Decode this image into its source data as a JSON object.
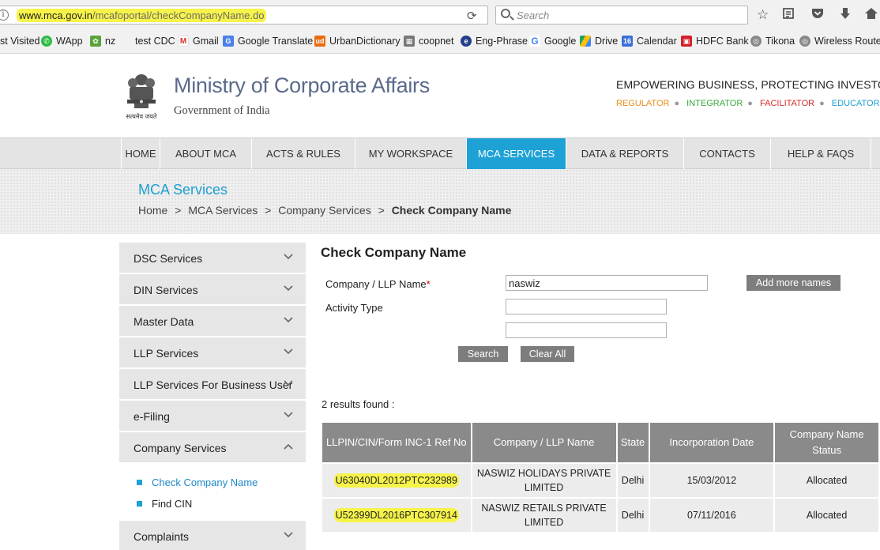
{
  "browser": {
    "url_host": "www.mca.gov.in",
    "url_path": "/mcafoportal/checkCompanyName.do",
    "search_placeholder": "Search",
    "bookmarks": [
      {
        "label": "st Visited"
      },
      {
        "label": "WApp"
      },
      {
        "label": "nz"
      },
      {
        "label": "test CDC"
      },
      {
        "label": "Gmail"
      },
      {
        "label": "Google Translate"
      },
      {
        "label": "UrbanDictionary"
      },
      {
        "label": "coopnet"
      },
      {
        "label": "Eng-Phrase"
      },
      {
        "label": "Google"
      },
      {
        "label": "Drive"
      },
      {
        "label": "Calendar"
      },
      {
        "label": "HDFC Bank"
      },
      {
        "label": "Tikona"
      },
      {
        "label": "Wireless Router"
      }
    ]
  },
  "header": {
    "title": "Ministry of Corporate Affairs",
    "subtitle": "Government of India",
    "emblem_caption": "सत्यमेव जयते",
    "tagline": "EMPOWERING BUSINESS, PROTECTING INVESTORS",
    "roles": [
      {
        "label": "REGULATOR",
        "color": "#e8901c"
      },
      {
        "label": "INTEGRATOR",
        "color": "#3aa839"
      },
      {
        "label": "FACILITATOR",
        "color": "#d62b2b"
      },
      {
        "label": "EDUCATOR",
        "color": "#1e9fd3"
      }
    ]
  },
  "nav": [
    {
      "label": "HOME"
    },
    {
      "label": "ABOUT MCA"
    },
    {
      "label": "ACTS & RULES"
    },
    {
      "label": "MY WORKSPACE"
    },
    {
      "label": "MCA SERVICES"
    },
    {
      "label": "DATA & REPORTS"
    },
    {
      "label": "CONTACTS"
    },
    {
      "label": "HELP & FAQS"
    }
  ],
  "breadcrumb": {
    "section_title": "MCA Services",
    "items": [
      "Home",
      "MCA Services",
      "Company Services",
      "Check Company Name"
    ],
    "separator": ">"
  },
  "sidebar": {
    "items": [
      {
        "label": "DSC Services"
      },
      {
        "label": "DIN Services"
      },
      {
        "label": "Master Data"
      },
      {
        "label": "LLP Services"
      },
      {
        "label": "LLP Services For Business User"
      },
      {
        "label": "e-Filing"
      },
      {
        "label": "Company Services"
      }
    ],
    "sub_items": [
      {
        "label": "Check Company Name"
      },
      {
        "label": "Find CIN"
      }
    ],
    "last_item": {
      "label": "Complaints"
    }
  },
  "form": {
    "title": "Check Company Name",
    "name_label": "Company / LLP Name",
    "required_mark": "*",
    "name_value": "naswiz",
    "activity_label": "Activity Type",
    "activity_value": "",
    "extra_value": "",
    "add_more_label": "Add more names",
    "search_label": "Search",
    "clear_label": "Clear All"
  },
  "results": {
    "summary": "2 results found :",
    "columns": [
      "LLPIN/CIN/Form INC-1 Ref No",
      "Company / LLP Name",
      "State",
      "Incorporation Date",
      "Company Name Status"
    ],
    "rows": [
      {
        "cin": "U63040DL2012PTC232989",
        "name": "NASWIZ HOLIDAYS PRIVATE LIMITED",
        "state": "Delhi",
        "date": "15/03/2012",
        "status": "Allocated"
      },
      {
        "cin": "U52399DL2016PTC307914",
        "name": "NASWIZ RETAILS PRIVATE LIMITED",
        "state": "Delhi",
        "date": "07/11/2016",
        "status": "Allocated"
      }
    ]
  }
}
